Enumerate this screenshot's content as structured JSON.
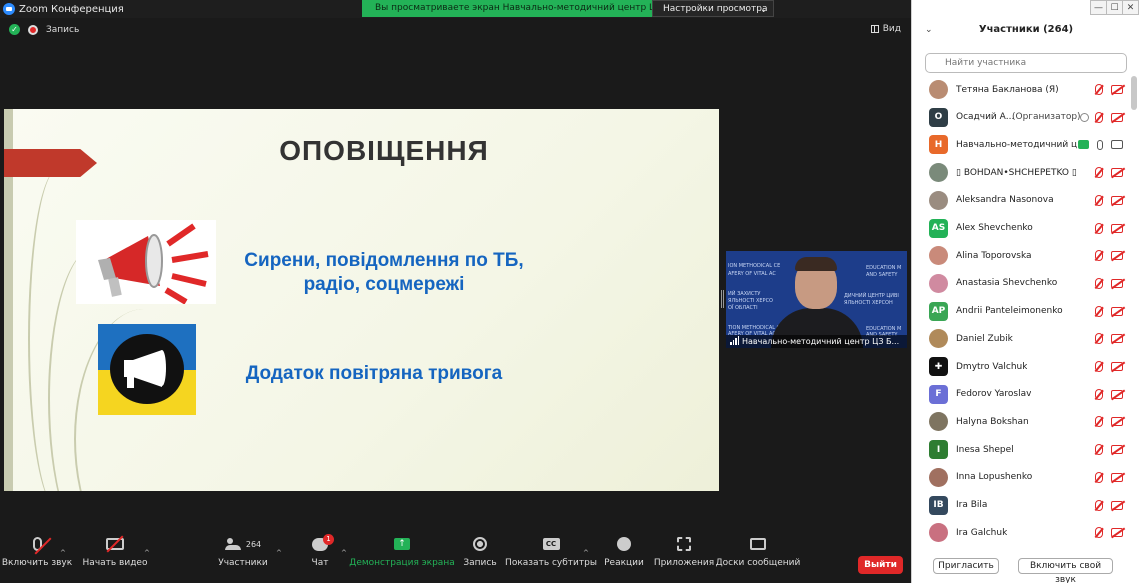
{
  "window": {
    "title": "Zoom Конференция"
  },
  "share_banner": {
    "text": "Вы просматриваете экран Навчально-методичний центр ЦЗ ..."
  },
  "view_settings": {
    "label": "Настройки просмотра"
  },
  "meeting": {
    "record_label": "Запись",
    "view_label": "Вид"
  },
  "slide": {
    "title": "ОПОВІЩЕННЯ",
    "line1": "Сирени, повідомлення по ТБ, радіо, соцмережі",
    "line2": "Додаток повітряна тривога"
  },
  "video": {
    "name": "Навчально-методичний центр ЦЗ Б...",
    "bg_texts": [
      "ION METHODICAL CE",
      "AFERY OF VITAL AC",
      "ИЙ ЗАХИСТУ",
      "ЯЛЬНОСТІ ХЕРСО",
      "ОЇ ОБЛАСТІ",
      "TION METHODICAL C",
      "AFERY OF VITAL AC",
      "EDUCATION M",
      "AND SAFETY",
      "ДИЧНИЙ ЦЕНТР ЦИВІ",
      "ЯЛЬНОСТІ ХЕРСОН",
      "EDUCATION M",
      "AND SAFETY"
    ]
  },
  "toolbar": {
    "audio": "Включить звук",
    "video": "Начать видео",
    "participants": "Участники",
    "participants_count": "264",
    "chat": "Чат",
    "chat_badge": "1",
    "share": "Демонстрация экрана",
    "record": "Запись",
    "subtitles": "Показать субтитры",
    "reactions": "Реакции",
    "apps": "Приложения",
    "whiteboards": "Доски сообщений",
    "leave": "Выйти"
  },
  "panel": {
    "title": "Участники (264)",
    "search_placeholder": "Найти участника",
    "invite": "Пригласить",
    "unmute": "Включить свой звук",
    "participants": [
      {
        "name": "Тетяна Бакланова (Я)",
        "avatar_text": "",
        "avatar_color": "#b98c72",
        "state": "muted"
      },
      {
        "name": "Осадчий А...",
        "role": "(Организатор)",
        "avatar_text": "О",
        "avatar_color": "#2f3e46",
        "state": "muted-host"
      },
      {
        "name": "Навчально-методичний ц...",
        "avatar_text": "Н",
        "avatar_color": "#e8692a",
        "state": "active"
      },
      {
        "name": "▯ BOHDAN•SHCHEPETKO ▯",
        "avatar_text": "",
        "avatar_color": "#7a8a7a",
        "state": "muted"
      },
      {
        "name": "Aleksandra Nasonova",
        "avatar_text": "",
        "avatar_color": "#9a8c80",
        "state": "muted"
      },
      {
        "name": "Alex Shevchenko",
        "avatar_text": "AS",
        "avatar_color": "#23b257",
        "state": "muted"
      },
      {
        "name": "Alina Toporovska",
        "avatar_text": "",
        "avatar_color": "#c98a7a",
        "state": "muted"
      },
      {
        "name": "Anastasia Shevchenko",
        "avatar_text": "",
        "avatar_color": "#d08aa0",
        "state": "muted"
      },
      {
        "name": "Andrii Panteleimonenko",
        "avatar_text": "AP",
        "avatar_color": "#3aa655",
        "state": "muted"
      },
      {
        "name": "Daniel Zubik",
        "avatar_text": "",
        "avatar_color": "#b08a5a",
        "state": "muted"
      },
      {
        "name": "Dmytro Valchuk",
        "avatar_text": "✚",
        "avatar_color": "#111111",
        "state": "muted"
      },
      {
        "name": "Fedorov Yaroslav",
        "avatar_text": "F",
        "avatar_color": "#6b6fd6",
        "state": "muted"
      },
      {
        "name": "Halyna Bokshan",
        "avatar_text": "",
        "avatar_color": "#7e7460",
        "state": "muted"
      },
      {
        "name": "Inesa Shepel",
        "avatar_text": "I",
        "avatar_color": "#2e7d32",
        "state": "muted"
      },
      {
        "name": "Inna Lopushenko",
        "avatar_text": "",
        "avatar_color": "#a07060",
        "state": "muted"
      },
      {
        "name": "Ira Bila",
        "avatar_text": "IB",
        "avatar_color": "#34495e",
        "state": "muted"
      },
      {
        "name": "Ira Galchuk",
        "avatar_text": "",
        "avatar_color": "#c97080",
        "state": "muted"
      }
    ]
  },
  "colors": {
    "accent_green": "#23b257",
    "leave_red": "#e02828",
    "slide_text_blue": "#1565c0"
  }
}
